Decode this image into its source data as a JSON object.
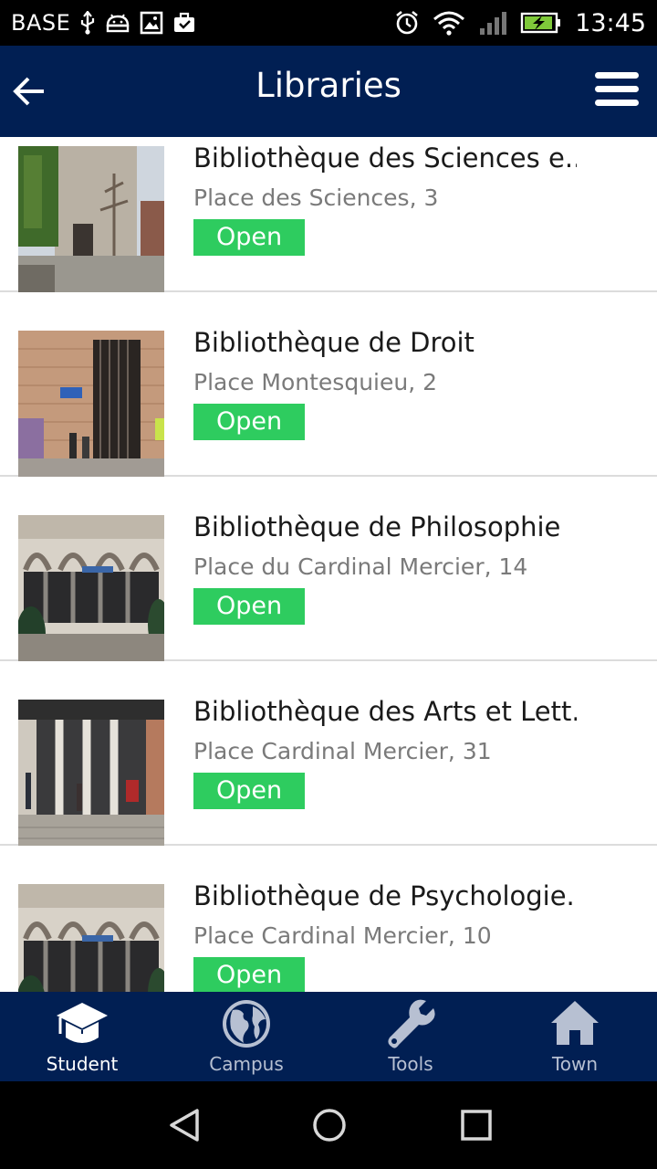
{
  "status_bar": {
    "carrier": "BASE",
    "time": "13:45",
    "icons": [
      "usb-icon",
      "android-debug-icon",
      "image-icon",
      "briefcase-icon",
      "alarm-icon",
      "wifi-icon",
      "signal-icon",
      "battery-charging-icon"
    ]
  },
  "app_bar": {
    "title": "Libraries",
    "back_icon": "arrow-left-icon",
    "menu_icon": "hamburger-menu-icon",
    "background": "#011f53"
  },
  "libraries": [
    {
      "name": "Bibliothèque des Sciences e..",
      "address": "Place des Sciences, 3",
      "status": "Open"
    },
    {
      "name": "Bibliothèque de Droit",
      "address": "Place Montesquieu, 2",
      "status": "Open"
    },
    {
      "name": "Bibliothèque de Philosophie",
      "address": "Place du Cardinal Mercier, 14",
      "status": "Open"
    },
    {
      "name": "Bibliothèque des Arts et Lett.",
      "address": "Place Cardinal Mercier, 31",
      "status": "Open"
    },
    {
      "name": "Bibliothèque de Psychologie..",
      "address": "Place Cardinal Mercier, 10",
      "status": "Open"
    }
  ],
  "status_color": "#2ecc5f",
  "bottom_nav": {
    "items": [
      {
        "label": "Student",
        "icon": "graduation-cap-icon",
        "active": true
      },
      {
        "label": "Campus",
        "icon": "globe-icon",
        "active": false
      },
      {
        "label": "Tools",
        "icon": "wrench-icon",
        "active": false
      },
      {
        "label": "Town",
        "icon": "home-icon",
        "active": false
      }
    ]
  },
  "system_nav": {
    "icons": [
      "back-triangle-icon",
      "home-circle-icon",
      "recents-square-icon"
    ]
  }
}
